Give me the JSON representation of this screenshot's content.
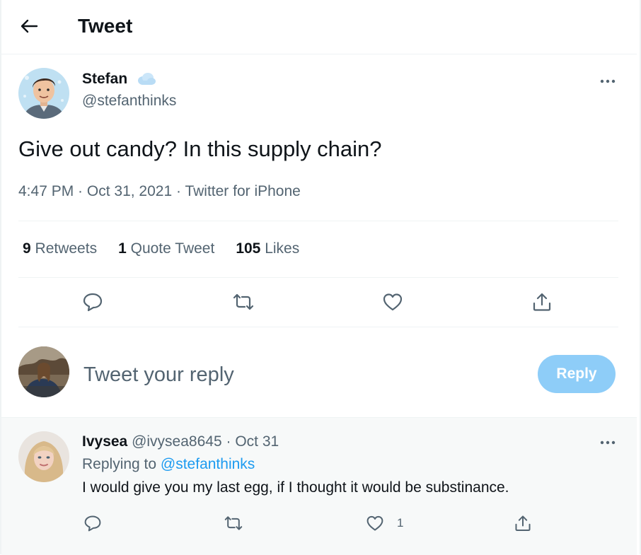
{
  "header": {
    "title": "Tweet"
  },
  "tweet": {
    "author_name": "Stefan",
    "author_handle": "@stefanthinks",
    "text": "Give out candy? In this supply chain?",
    "time": "4:47 PM",
    "date": "Oct 31, 2021",
    "source": "Twitter for iPhone",
    "retweets_count": "9",
    "retweets_label": "Retweets",
    "quotes_count": "1",
    "quotes_label": "Quote Tweet",
    "likes_count": "105",
    "likes_label": "Likes"
  },
  "composer": {
    "placeholder": "Tweet your reply",
    "button_label": "Reply"
  },
  "reply": {
    "author_name": "Ivysea",
    "author_handle": "@ivysea8645",
    "date": "Oct 31",
    "replying_prefix": "Replying to",
    "replying_handle": "@stefanthinks",
    "text": "I would give you my last egg, if I thought it would be substinance.",
    "like_count": "1"
  },
  "colors": {
    "accent": "#1d9bf0",
    "reply_button": "#8ecdf8",
    "muted": "#536471"
  },
  "icons": [
    "back-arrow-icon",
    "cloud-badge-icon",
    "more-icon",
    "reply-icon",
    "retweet-icon",
    "like-icon",
    "share-icon"
  ]
}
